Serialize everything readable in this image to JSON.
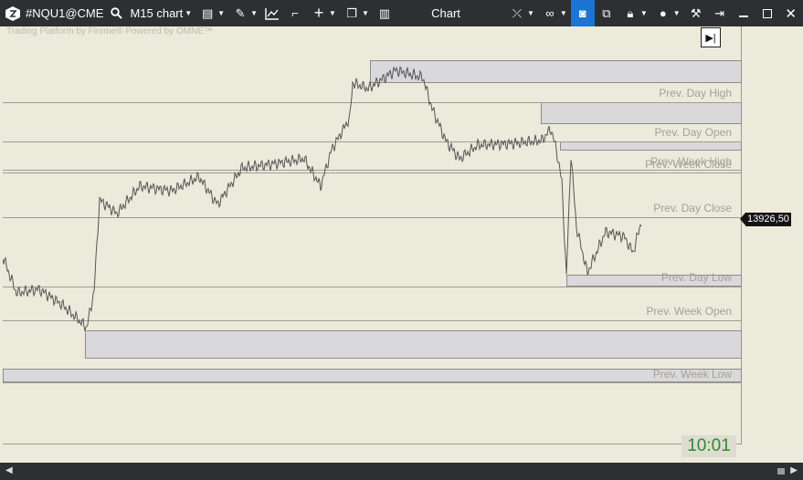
{
  "toolbar": {
    "symbol": "#NQU1@CME",
    "chart_type": "M15 chart",
    "title": "Chart"
  },
  "chart": {
    "watermark": "Trading Platform by FinIme® Powered by OMNE™",
    "current_price": "13926,50",
    "clock": "10:01",
    "levels": [
      {
        "label": "Prev. Day High"
      },
      {
        "label": "Prev. Day Open"
      },
      {
        "label": "Prev. Week High"
      },
      {
        "label": "Prev. Week Close"
      },
      {
        "label": "Prev. Day Close"
      },
      {
        "label": "Prev. Day Low"
      },
      {
        "label": "Prev. Week Open"
      },
      {
        "label": "Prev. Week Low"
      }
    ]
  }
}
